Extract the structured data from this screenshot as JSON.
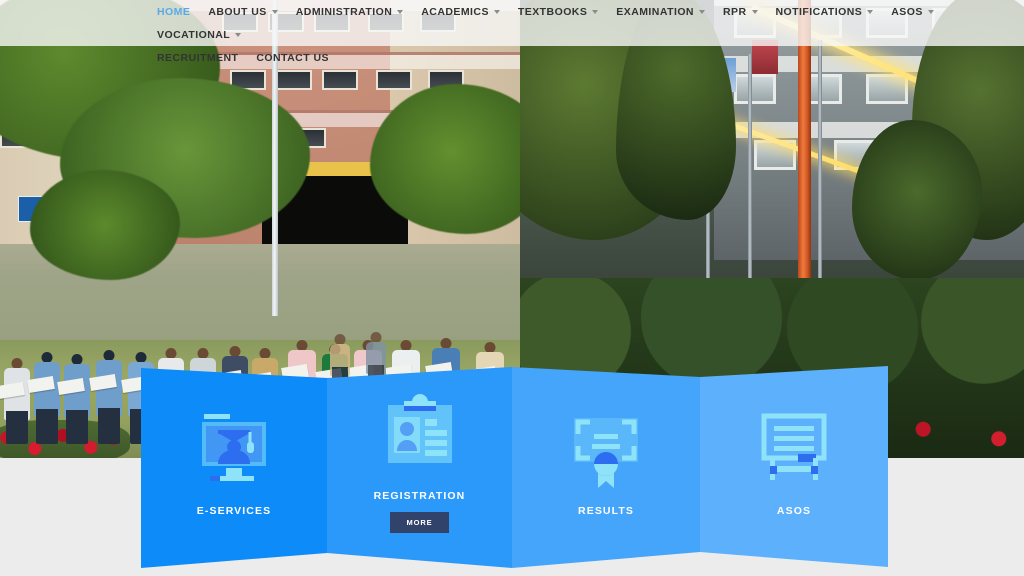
{
  "site": {
    "background_color": "#ececec"
  },
  "nav": {
    "items": [
      {
        "label": "HOME",
        "has_dropdown": false,
        "active": true,
        "row": 1
      },
      {
        "label": "ABOUT US",
        "has_dropdown": true,
        "active": false,
        "row": 1
      },
      {
        "label": "ADMINISTRATION",
        "has_dropdown": true,
        "active": false,
        "row": 1
      },
      {
        "label": "ACADEMICS",
        "has_dropdown": true,
        "active": false,
        "row": 1
      },
      {
        "label": "TEXTBOOKS",
        "has_dropdown": true,
        "active": false,
        "row": 1
      },
      {
        "label": "EXAMINATION",
        "has_dropdown": true,
        "active": false,
        "row": 1
      },
      {
        "label": "RPR",
        "has_dropdown": true,
        "active": false,
        "row": 1
      },
      {
        "label": "NOTIFICATIONS",
        "has_dropdown": true,
        "active": false,
        "row": 1
      },
      {
        "label": "ASOS",
        "has_dropdown": true,
        "active": false,
        "row": 1
      },
      {
        "label": "VOCATIONAL",
        "has_dropdown": true,
        "active": false,
        "row": 1
      },
      {
        "label": "RECRUITMENT",
        "has_dropdown": false,
        "active": false,
        "row": 2
      },
      {
        "label": "CONTACT US",
        "has_dropdown": false,
        "active": false,
        "row": 2
      }
    ],
    "active_item": "HOME",
    "active_color": "#5aa9e6",
    "text_color": "#333333",
    "background": "rgba(247,247,247,0.80)"
  },
  "hero": {
    "left_scene_description": "Daytime pledge ceremony outside institutional building with flagpole",
    "right_scene_description": "Illuminated building at dusk with flagpoles and garden hedge"
  },
  "panels": {
    "items": [
      {
        "label": "E-SERVICES",
        "icon": "graduate-monitor-icon",
        "color": "#0d8bf9",
        "has_more_button": false,
        "more_label": ""
      },
      {
        "label": "REGISTRATION",
        "icon": "id-card-clipboard-icon",
        "color": "#2b99fa",
        "has_more_button": true,
        "more_label": "MORE"
      },
      {
        "label": "RESULTS",
        "icon": "certificate-seal-icon",
        "color": "#44a5fb",
        "has_more_button": false,
        "more_label": ""
      },
      {
        "label": "ASOS",
        "icon": "presentation-board-icon",
        "color": "#5cb0fc",
        "has_more_button": false,
        "more_label": ""
      }
    ],
    "more_button_color": "#32436b",
    "label_color": "#ffffff",
    "icon_light_color": "#8fe3f9",
    "icon_accent_color": "#2d6df0"
  }
}
